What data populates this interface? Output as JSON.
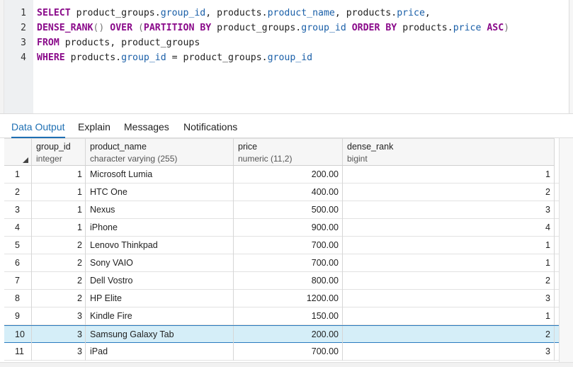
{
  "editor": {
    "line_numbers": [
      "1",
      "2",
      "3",
      "4"
    ]
  },
  "tabs": [
    {
      "label": "Data Output",
      "active": true
    },
    {
      "label": "Explain",
      "active": false
    },
    {
      "label": "Messages",
      "active": false
    },
    {
      "label": "Notifications",
      "active": false
    }
  ],
  "grid": {
    "columns": [
      {
        "name": "group_id",
        "type": "integer"
      },
      {
        "name": "product_name",
        "type": "character varying (255)"
      },
      {
        "name": "price",
        "type": "numeric (11,2)"
      },
      {
        "name": "dense_rank",
        "type": "bigint"
      }
    ],
    "rows": [
      {
        "n": "1",
        "group_id": "1",
        "product_name": "Microsoft Lumia",
        "price": "200.00",
        "dense_rank": "1"
      },
      {
        "n": "2",
        "group_id": "1",
        "product_name": "HTC One",
        "price": "400.00",
        "dense_rank": "2"
      },
      {
        "n": "3",
        "group_id": "1",
        "product_name": "Nexus",
        "price": "500.00",
        "dense_rank": "3"
      },
      {
        "n": "4",
        "group_id": "1",
        "product_name": "iPhone",
        "price": "900.00",
        "dense_rank": "4"
      },
      {
        "n": "5",
        "group_id": "2",
        "product_name": "Lenovo Thinkpad",
        "price": "700.00",
        "dense_rank": "1"
      },
      {
        "n": "6",
        "group_id": "2",
        "product_name": "Sony VAIO",
        "price": "700.00",
        "dense_rank": "1"
      },
      {
        "n": "7",
        "group_id": "2",
        "product_name": "Dell Vostro",
        "price": "800.00",
        "dense_rank": "2"
      },
      {
        "n": "8",
        "group_id": "2",
        "product_name": "HP Elite",
        "price": "1200.00",
        "dense_rank": "3"
      },
      {
        "n": "9",
        "group_id": "3",
        "product_name": "Kindle Fire",
        "price": "150.00",
        "dense_rank": "1"
      },
      {
        "n": "10",
        "group_id": "3",
        "product_name": "Samsung Galaxy Tab",
        "price": "200.00",
        "dense_rank": "2"
      },
      {
        "n": "11",
        "group_id": "3",
        "product_name": "iPad",
        "price": "700.00",
        "dense_rank": "3"
      }
    ],
    "selected_row": "10"
  },
  "colors": {
    "keyword": "#8a0a8a",
    "identifier": "#1a5fa8",
    "active_tab": "#1e6fb3",
    "selected_row": "#d5eef8"
  }
}
